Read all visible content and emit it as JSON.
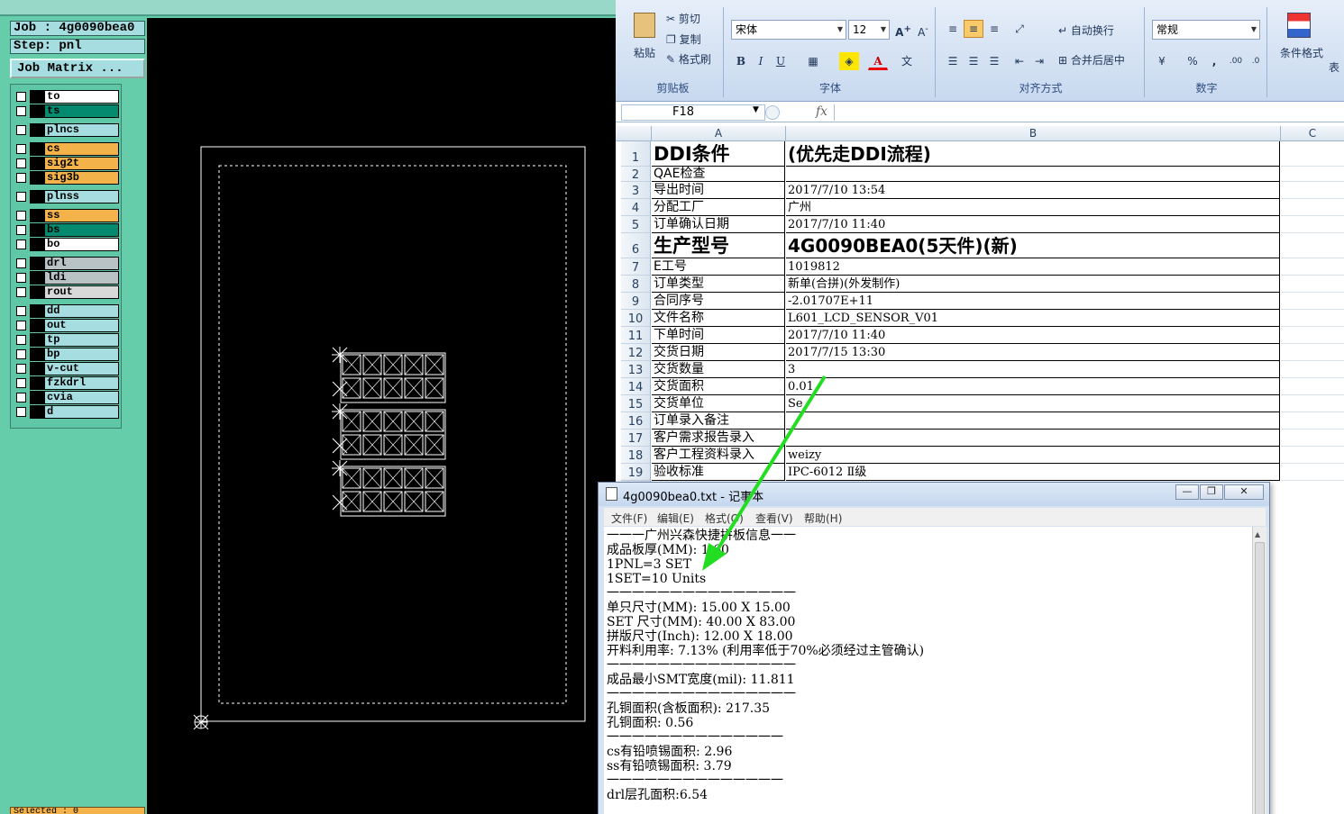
{
  "cam": {
    "job_label": "Job : 4g0090bea0",
    "step_label": "Step: pnl",
    "job_matrix_button": "Job Matrix ...",
    "status_text": "Selected : 0",
    "colors": {
      "background": "#66cdaa",
      "canvas": "#000000",
      "outer_layer": "#f4b24b",
      "inner_layer": "#048a6e",
      "drill_layer": "#b9c3c6"
    },
    "layers": [
      {
        "name": "to",
        "color": "#ffffff"
      },
      {
        "name": "ts",
        "color": "#048a6e"
      },
      {
        "name": "plncs",
        "color": "#a5dde0"
      },
      {
        "name": "cs",
        "color": "#f4b24b"
      },
      {
        "name": "sig2t",
        "color": "#f4b24b"
      },
      {
        "name": "sig3b",
        "color": "#f4b24b"
      },
      {
        "name": "plnss",
        "color": "#a5dde0"
      },
      {
        "name": "ss",
        "color": "#f4b24b"
      },
      {
        "name": "bs",
        "color": "#048a6e"
      },
      {
        "name": "bo",
        "color": "#ffffff"
      },
      {
        "name": "drl",
        "color": "#b9c3c6"
      },
      {
        "name": "ldi",
        "color": "#b9c3c6"
      },
      {
        "name": "rout",
        "color": "#d9d9d9"
      },
      {
        "name": "dd",
        "color": "#a5dde0"
      },
      {
        "name": "out",
        "color": "#a5dde0"
      },
      {
        "name": "tp",
        "color": "#a5dde0"
      },
      {
        "name": "bp",
        "color": "#a5dde0"
      },
      {
        "name": "v-cut",
        "color": "#a5dde0"
      },
      {
        "name": "fzkdrl",
        "color": "#a5dde0"
      },
      {
        "name": "cvia",
        "color": "#a5dde0"
      },
      {
        "name": "d",
        "color": "#a5dde0"
      }
    ]
  },
  "excel": {
    "ribbon": {
      "clipboard": {
        "paste": "粘贴",
        "cut": "剪切",
        "copy": "复制",
        "format_painter": "格式刷",
        "group": "剪贴板"
      },
      "font": {
        "name": "宋体",
        "size": "12",
        "bold": "B",
        "italic": "I",
        "underline": "U",
        "font_color": "A",
        "group": "字体"
      },
      "alignment": {
        "wrap_text": "自动换行",
        "merge_center": "合并后居中",
        "group": "对齐方式"
      },
      "number": {
        "format": "常规",
        "percent": "%",
        "comma": ",",
        "group": "数字"
      },
      "styles": {
        "conditional_format": "条件格式",
        "table_format": "表"
      }
    },
    "name_box": "F18",
    "fx": "fx",
    "columns": [
      "A",
      "B",
      "C"
    ],
    "rows": [
      {
        "num": "1",
        "a": "DDI条件",
        "b": "(优先走DDI流程)"
      },
      {
        "num": "2",
        "a": "QAE检查",
        "b": ""
      },
      {
        "num": "3",
        "a": "导出时间",
        "b": "2017/7/10 13:54"
      },
      {
        "num": "4",
        "a": "分配工厂",
        "b": "广州"
      },
      {
        "num": "5",
        "a": "订单确认日期",
        "b": "2017/7/10 11:40"
      },
      {
        "num": "6",
        "a": "生产型号",
        "b": "4G0090BEA0(5天件)(新)"
      },
      {
        "num": "7",
        "a": "E工号",
        "b": "1019812"
      },
      {
        "num": "8",
        "a": "订单类型",
        "b": "新单(合拼)(外发制作)"
      },
      {
        "num": "9",
        "a": "合同序号",
        "b": "-2.01707E+11"
      },
      {
        "num": "10",
        "a": "文件名称",
        "b": "L601_LCD_SENSOR_V01"
      },
      {
        "num": "11",
        "a": "下单时间",
        "b": "2017/7/10 11:40"
      },
      {
        "num": "12",
        "a": "交货日期",
        "b": "2017/7/15 13:30"
      },
      {
        "num": "13",
        "a": "交货数量",
        "b": "3"
      },
      {
        "num": "14",
        "a": "交货面积",
        "b": "0.01"
      },
      {
        "num": "15",
        "a": "交货单位",
        "b": "Se"
      },
      {
        "num": "16",
        "a": "订单录入备注",
        "b": ""
      },
      {
        "num": "17",
        "a": "客户需求报告录入",
        "b": ""
      },
      {
        "num": "18",
        "a": "客户工程资料录入",
        "b": "weizy"
      },
      {
        "num": "19",
        "a": "验收标准",
        "b": "IPC-6012 Ⅱ级"
      }
    ]
  },
  "notepad": {
    "title": "4g0090bea0.txt - 记事本",
    "menu": [
      "文件(F)",
      "编辑(E)",
      "格式(O)",
      "查看(V)",
      "帮助(H)"
    ],
    "lines": [
      "一一一广州兴森快捷拼板信息一一",
      "成品板厚(MM): 1.60",
      "1PNL=3 SET",
      "1SET=10 Units",
      "一一一一一一一一一一一一一一一",
      "单只尺寸(MM): 15.00 X 15.00",
      "SET 尺寸(MM): 40.00 X 83.00",
      "拼版尺寸(Inch): 12.00 X 18.00",
      "开料利用率: 7.13% (利用率低于70%必须经过主管确认)",
      "一一一一一一一一一一一一一一一",
      "成品最小SMT宽度(mil): 11.811",
      "一一一一一一一一一一一一一一一",
      "孔铜面积(含板面积): 217.35",
      "孔铜面积: 0.56",
      "一一一一一一一一一一一一一一",
      "cs有铅喷锡面积: 2.96",
      "ss有铅喷锡面积: 3.79",
      "一一一一一一一一一一一一一一",
      "drl层孔面积:6.54"
    ]
  },
  "arrow_color": "#22dd22"
}
